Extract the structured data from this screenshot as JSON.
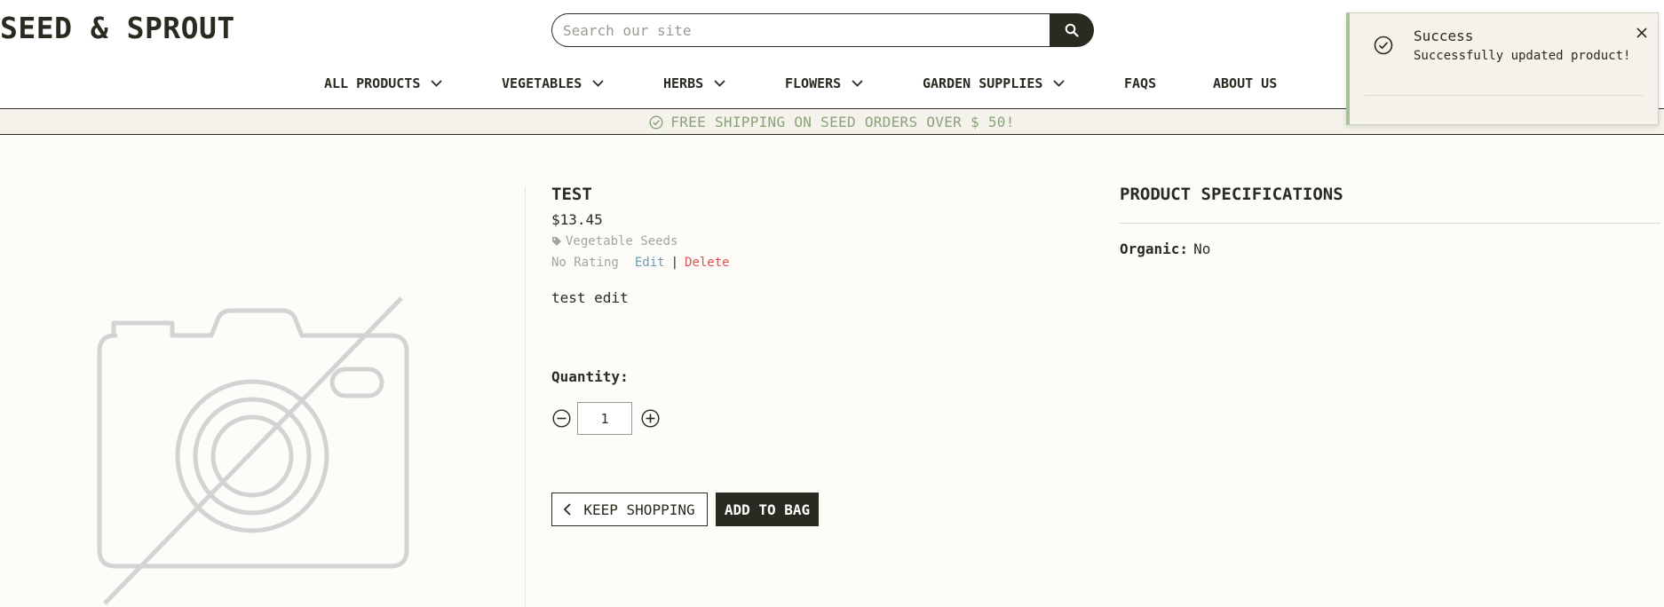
{
  "brand": {
    "logo_text": "SEED & SPROUT"
  },
  "search": {
    "placeholder": "Search our site",
    "button_icon": "search-icon"
  },
  "nav": {
    "items": [
      {
        "label": "ALL PRODUCTS",
        "has_dropdown": true
      },
      {
        "label": "VEGETABLES",
        "has_dropdown": true
      },
      {
        "label": "HERBS",
        "has_dropdown": true
      },
      {
        "label": "FLOWERS",
        "has_dropdown": true
      },
      {
        "label": "GARDEN SUPPLIES",
        "has_dropdown": true
      },
      {
        "label": "FAQS",
        "has_dropdown": false
      },
      {
        "label": "ABOUT US",
        "has_dropdown": false
      }
    ]
  },
  "promo": {
    "text": "FREE SHIPPING ON SEED ORDERS OVER $ 50!",
    "icon": "check-circle-icon"
  },
  "product": {
    "image_icon": "no-image-camera-icon",
    "title": "TEST",
    "price": "$13.45",
    "category": "Vegetable Seeds",
    "rating": "No Rating",
    "edit_label": "Edit",
    "separator": "|",
    "delete_label": "Delete",
    "description": "test edit",
    "quantity_label": "Quantity:",
    "quantity_value": "1",
    "keep_shopping_label": "KEEP SHOPPING",
    "add_to_bag_label": "ADD TO BAG"
  },
  "specs": {
    "title": "PRODUCT SPECIFICATIONS",
    "rows": [
      {
        "key": "Organic:",
        "value": "No"
      }
    ]
  },
  "toast": {
    "title": "Success",
    "message": "Successfully updated product!",
    "icon": "check-circle-icon",
    "close_icon": "close-icon"
  },
  "colors": {
    "primary": "#2b2a20",
    "background": "#fdfcf8",
    "promo_text": "#8aa37a",
    "edit_link": "#6a9bb8",
    "delete_link": "#d9534f",
    "muted": "#a5a49c"
  }
}
